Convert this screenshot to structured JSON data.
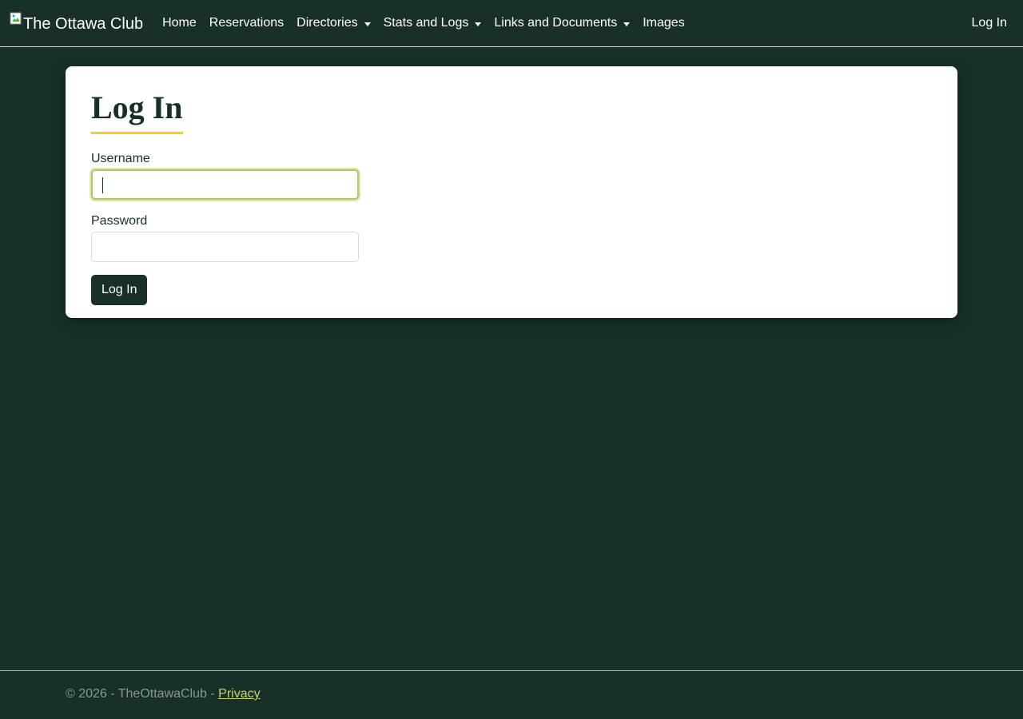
{
  "navbar": {
    "brand": "The Ottawa Club",
    "items": [
      {
        "label": "Home",
        "dropdown": false
      },
      {
        "label": "Reservations",
        "dropdown": false
      },
      {
        "label": "Directories",
        "dropdown": true
      },
      {
        "label": "Stats and Logs",
        "dropdown": true
      },
      {
        "label": "Links and Documents",
        "dropdown": true
      },
      {
        "label": "Images",
        "dropdown": false
      }
    ],
    "login": "Log In"
  },
  "login_form": {
    "title": "Log In",
    "username_label": "Username",
    "username_value": "",
    "password_label": "Password",
    "password_value": "",
    "submit_label": "Log In"
  },
  "footer": {
    "copyright": "© 2026 - TheOttawaClub - ",
    "privacy_link": "Privacy"
  },
  "colors": {
    "background": "#19302a",
    "accent_yellow": "#f4cf17",
    "focus_green": "#b6c565",
    "link": "#c6d36b"
  }
}
